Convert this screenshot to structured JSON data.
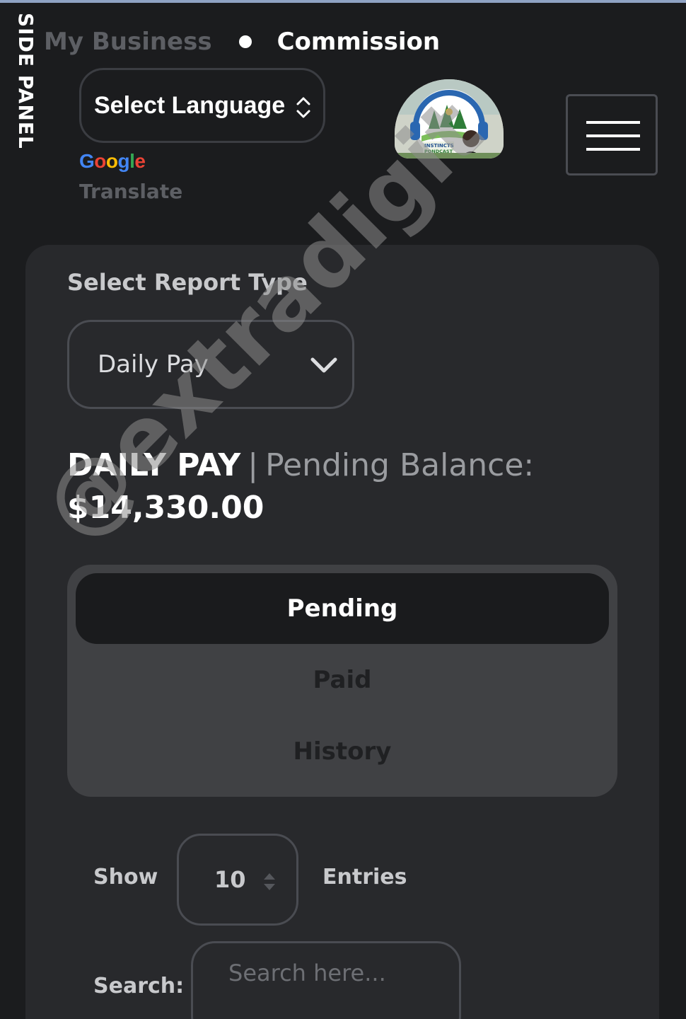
{
  "side_panel": {
    "label": "SIDE PANEL"
  },
  "breadcrumb": {
    "parent": "My Business",
    "current": "Commission"
  },
  "language": {
    "select_label": "Select Language",
    "brand": [
      "G",
      "o",
      "o",
      "g",
      "l",
      "e"
    ],
    "translate_label": "Translate"
  },
  "logo": {
    "text_line1": "INSTINCTS",
    "text_line2": "PONDCAST"
  },
  "menu": {
    "icon": "hamburger-icon"
  },
  "report": {
    "label": "Select Report Type",
    "selected": "Daily Pay",
    "title": "DAILY PAY",
    "divider": "|",
    "balance_label": "Pending Balance:",
    "balance_amount": "$14,330.00"
  },
  "tabs": [
    {
      "label": "Pending",
      "active": true
    },
    {
      "label": "Paid",
      "active": false
    },
    {
      "label": "History",
      "active": false
    }
  ],
  "table_controls": {
    "show_label": "Show",
    "entries_value": "10",
    "entries_label": "Entries",
    "search_label": "Search:",
    "search_placeholder": "Search here..."
  },
  "watermark": {
    "text": "@extradigit"
  },
  "colors": {
    "background": "#1b1c1e",
    "card": "#28292c",
    "tab_panel": "#404144",
    "active_tab": "#1a1b1d",
    "muted_text": "#5d5f64"
  }
}
